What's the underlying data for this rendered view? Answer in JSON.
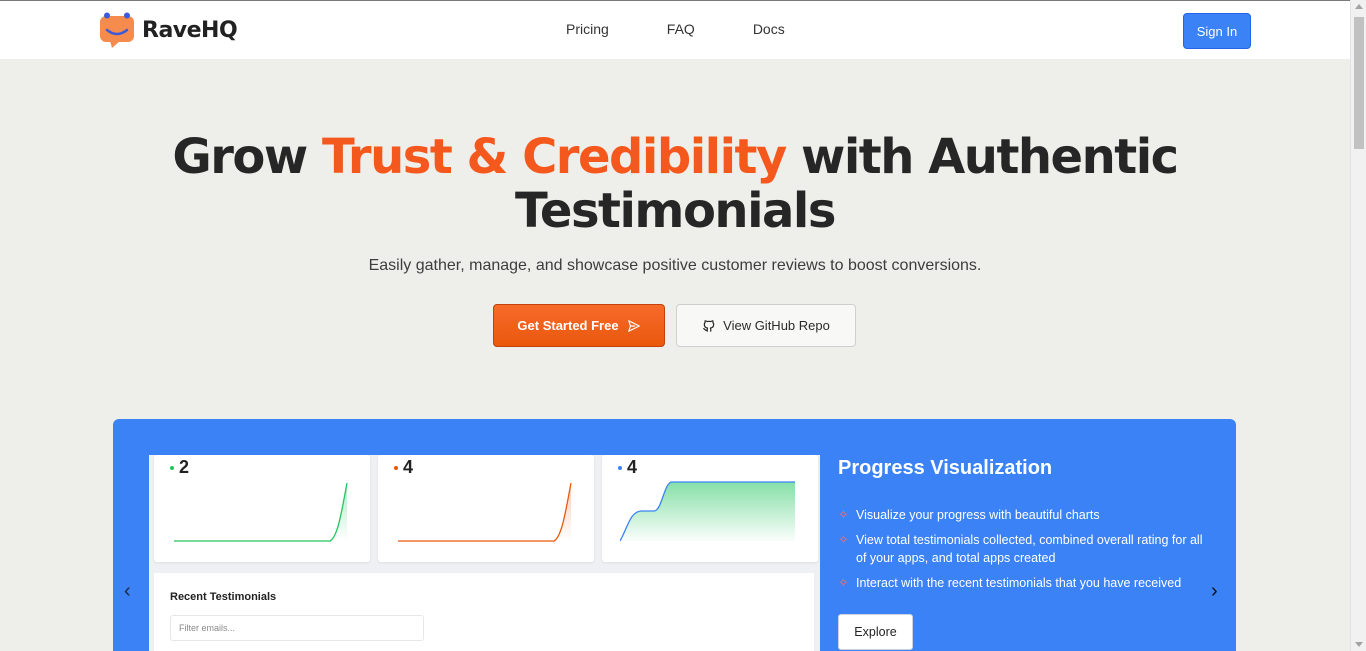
{
  "brand": {
    "name": "RaveHQ",
    "logo_color": "#f4581c"
  },
  "nav": {
    "items": [
      "Pricing",
      "FAQ",
      "Docs"
    ],
    "signin_label": "Sign In"
  },
  "hero": {
    "title_part1": "Grow ",
    "title_accent": "Trust & Credibility",
    "title_part2": " with Authentic",
    "title_line2": "Testimonials",
    "subtitle": "Easily gather, manage, and showcase positive customer reviews to boost conversions.",
    "primary_cta": "Get Started Free",
    "secondary_cta": "View GitHub Repo"
  },
  "showcase": {
    "stats": [
      {
        "value": "2",
        "color": "#22c55e"
      },
      {
        "value": "4",
        "color": "#ea580c"
      },
      {
        "value": "4",
        "color": "#3b82f6"
      }
    ],
    "recent_title": "Recent Testimonials",
    "filter_placeholder": "Filter emails...",
    "feature_title": "Progress Visualization",
    "features": [
      "Visualize your progress with beautiful charts",
      "View total testimonials collected, combined overall rating for all of your apps, and total apps created",
      "Interact with the recent testimonials that you have received"
    ],
    "explore_label": "Explore"
  },
  "colors": {
    "accent": "#f4581c",
    "panel": "#3b82f6",
    "primary_button": "#ea580c"
  }
}
